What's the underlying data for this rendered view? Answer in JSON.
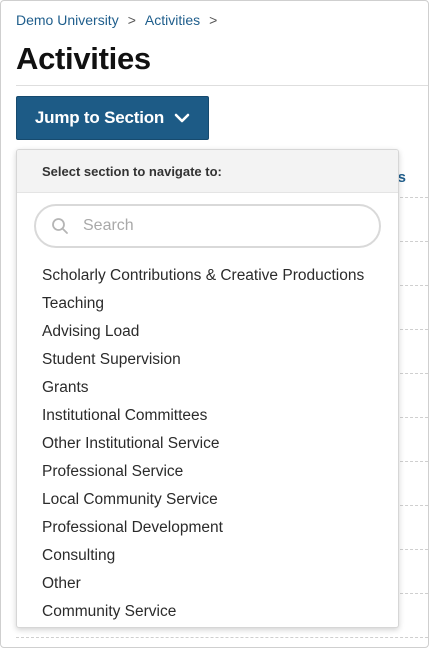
{
  "breadcrumb": {
    "items": [
      {
        "label": "Demo University"
      },
      {
        "label": "Activities"
      }
    ],
    "separator": ">"
  },
  "page": {
    "title": "Activities"
  },
  "jump_button": {
    "label": "Jump to Section",
    "icon": "chevron-down-icon"
  },
  "background": {
    "partial_link": "s"
  },
  "dropdown": {
    "header": "Select section to navigate to:",
    "search_placeholder": "Search",
    "sections": [
      "Scholarly Contributions & Creative Productions",
      "Teaching",
      "Advising Load",
      "Student Supervision",
      "Grants",
      "Institutional Committees",
      "Other Institutional Service",
      "Professional Service",
      "Local Community Service",
      "Professional Development",
      "Consulting",
      "Other",
      "Community Service"
    ]
  },
  "colors": {
    "brand": "#1d5b86",
    "link": "#1f5e8c"
  }
}
